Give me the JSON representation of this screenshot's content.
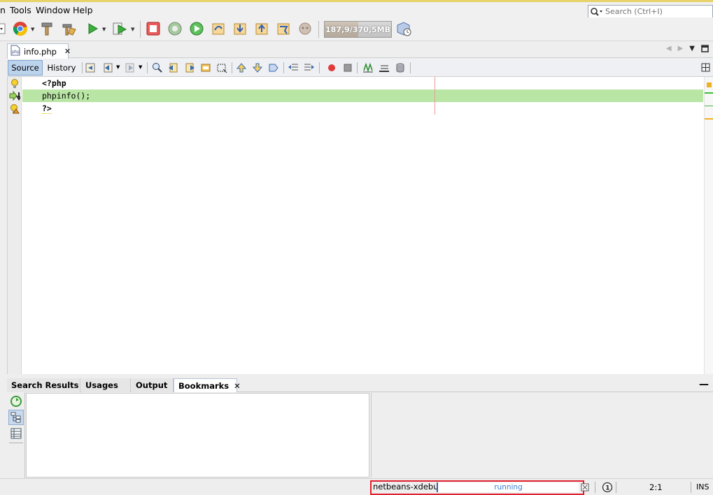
{
  "menubar": {
    "items": [
      "n",
      "Tools",
      "Window",
      "Help"
    ],
    "search_placeholder": "Search (Ctrl+I)"
  },
  "toolbar": {
    "memory_label": "187,9/370,5MB",
    "memory_fraction": 0.51
  },
  "editor_tabs": {
    "file_name": "info.php",
    "close_glyph": "✕"
  },
  "editor_toolbar": {
    "source_label": "Source",
    "history_label": "History"
  },
  "code": {
    "lines": [
      "<?php",
      "phpinfo();",
      "?>"
    ],
    "current_line_index": 1
  },
  "bottom_panel": {
    "tabs": [
      "Search Results",
      "Usages",
      "Output",
      "Bookmarks"
    ],
    "active_tab": "Bookmarks",
    "close_glyph": "✕",
    "minimize_glyph": "—"
  },
  "statusbar": {
    "session_name": "netbeans-xdebug",
    "progress_text": "running",
    "caret_position": "2:1",
    "insert_mode": "INS",
    "notifications_count": "1"
  },
  "colors": {
    "current_line": "#b9e5a5",
    "highlight_border": "#e0202e",
    "progress_text": "#3b7fd0",
    "margin_line": "#ef9a9a"
  }
}
